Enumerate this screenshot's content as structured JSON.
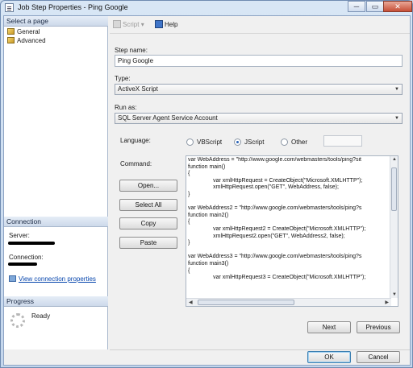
{
  "window": {
    "title": "Job Step Properties - Ping Google",
    "buttons": {
      "minimize": "─",
      "maximize": "▭",
      "close": "✕"
    }
  },
  "left_panel": {
    "select_page_header": "Select a page",
    "pages": [
      "General",
      "Advanced"
    ],
    "connection_header": "Connection",
    "server_label": "Server:",
    "connection_label": "Connection:",
    "view_connection_link": "View connection properties",
    "progress_header": "Progress",
    "progress_status": "Ready"
  },
  "toolbar": {
    "script_label": "Script",
    "script_dropdown": "▾",
    "help_label": "Help"
  },
  "form": {
    "step_name_label": "Step name:",
    "step_name_value": "Ping Google",
    "type_label": "Type:",
    "type_value": "ActiveX Script",
    "run_as_label": "Run as:",
    "run_as_value": "SQL Server Agent Service Account",
    "language_label": "Language:",
    "language_options": [
      "VBScript",
      "JScript",
      "Other"
    ],
    "language_selected": "JScript",
    "command_label": "Command:",
    "command_text": "var WebAddress = \"http://www.google.com/webmasters/tools/ping?sit\nfunction main()\n{\n                var xmlHttpRequest = CreateObject(\"Microsoft.XMLHTTP\");\n                xmlHttpRequest.open(\"GET\", WebAddress, false);\n}\n\nvar WebAddress2 = \"http://www.google.com/webmasters/tools/ping?s\nfunction main2()\n{\n                var xmlHttpRequest2 = CreateObject(\"Microsoft.XMLHTTP\");\n                xmlHttpRequest2.open(\"GET\", WebAddress2, false);\n}\n\nvar WebAddress3 = \"http://www.google.com/webmasters/tools/ping?s\nfunction main3()\n{\n                var xmlHttpRequest3 = CreateObject(\"Microsoft.XMLHTTP\");",
    "side_buttons": [
      "Open...",
      "Select All",
      "Copy",
      "Paste"
    ]
  },
  "footer": {
    "next_label": "Next",
    "previous_label": "Previous",
    "ok_label": "OK",
    "cancel_label": "Cancel"
  },
  "colors": {
    "title_bar": "#c4d6ec",
    "section_header": "#cdd9ea",
    "link": "#0645ad",
    "close_button": "#c64e36"
  }
}
